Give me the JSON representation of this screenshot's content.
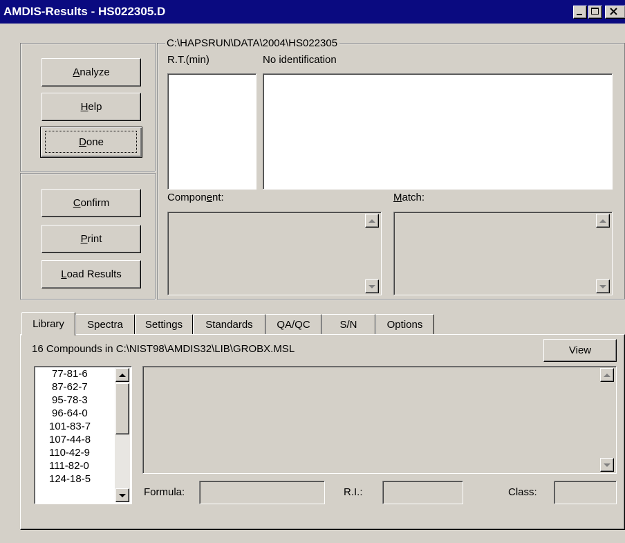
{
  "window": {
    "title": "AMDIS-Results - HS022305.D",
    "controls": {
      "minimize": "minimize-icon",
      "maximize": "maximize-icon",
      "close": "close-icon"
    }
  },
  "actions": {
    "analyze": {
      "pre": "",
      "key": "A",
      "post": "nalyze"
    },
    "help": {
      "pre": "",
      "key": "H",
      "post": "elp"
    },
    "done": {
      "pre": "",
      "key": "D",
      "post": "one"
    },
    "confirm": {
      "pre": "",
      "key": "C",
      "post": "onfirm"
    },
    "print": {
      "pre": "",
      "key": "P",
      "post": "rint"
    },
    "load_results": {
      "pre": "",
      "key": "L",
      "post": "oad Results"
    }
  },
  "results": {
    "path": "C:\\HAPSRUN\\DATA\\2004\\HS022305",
    "rt_label": "R.T.(min)",
    "identification_label": "No identification",
    "component_label": {
      "pre": "Compon",
      "key": "e",
      "post": "nt:"
    },
    "match_label": {
      "pre": "",
      "key": "M",
      "post": "atch:"
    }
  },
  "tabs": [
    "Library",
    "Spectra",
    "Settings",
    "Standards",
    "QA/QC",
    "S/N",
    "Options"
  ],
  "active_tab": "Library",
  "library": {
    "summary": "16 Compounds in C:\\NIST98\\AMDIS32\\LIB\\GROBX.MSL",
    "view_button": "View",
    "compounds": [
      "77-81-6",
      "87-62-7",
      "95-78-3",
      "96-64-0",
      "101-83-7",
      "107-44-8",
      "110-42-9",
      "111-82-0",
      "124-18-5"
    ],
    "formula_label": "Formula:",
    "formula_value": "",
    "ri_label": "R.I.:",
    "ri_value": "",
    "class_label": "Class:",
    "class_value": ""
  },
  "colors": {
    "titlebar": "#0a0a80",
    "face": "#d4d0c8",
    "field": "#ffffff"
  }
}
